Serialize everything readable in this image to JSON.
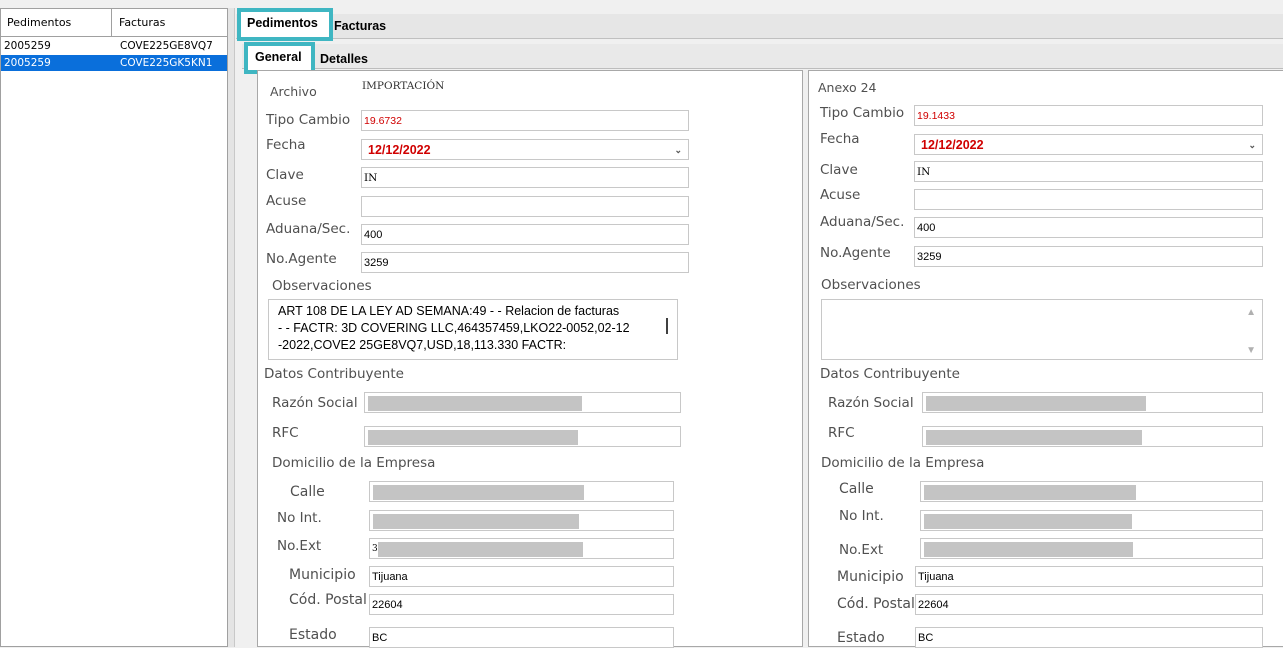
{
  "left_list": {
    "headers": [
      "Pedimentos",
      "Facturas"
    ],
    "rows": [
      {
        "pedimento": "2005259",
        "factura": "COVE225GE8VQ7",
        "selected": false
      },
      {
        "pedimento": "2005259",
        "factura": "COVE225GK5KN1",
        "selected": true
      }
    ]
  },
  "tabs": {
    "main": [
      "Pedimentos",
      "Facturas"
    ],
    "sub": [
      "General",
      "Detalles"
    ]
  },
  "left_form": {
    "archivo_label": "Archivo",
    "archivo_value": "IMPORTACIÓN",
    "tipo_cambio_label": "Tipo Cambio",
    "tipo_cambio": "19.6732",
    "fecha_label": "Fecha",
    "fecha": "12/12/2022",
    "clave_label": "Clave",
    "clave": "IN",
    "acuse_label": "Acuse",
    "acuse": "",
    "aduana_label": "Aduana/Sec.",
    "aduana": "400",
    "agente_label": "No.Agente",
    "agente": "3259",
    "obs_label": "Observaciones",
    "obs_lines": [
      "ART 108 DE LA LEY AD SEMANA:49 - - Relacion de facturas",
      "- - FACTR: 3D COVERING LLC,464357459,LKO22-0052,02-12",
      "-2022,COVE2 25GE8VQ7,USD,18,113.330 FACTR:"
    ],
    "datos_label": "Datos Contribuyente",
    "razon_label": "Razón Social",
    "rfc_label": "RFC",
    "domicilio_label": "Domicilio de la Empresa",
    "calle_label": "Calle",
    "noint_label": "No Int.",
    "noext_label": "No.Ext",
    "noext_value": "3",
    "municipio_label": "Municipio",
    "municipio": "Tijuana",
    "cp_label": "Cód. Postal",
    "cp": "22604",
    "estado_label": "Estado",
    "estado": "BC"
  },
  "right_form": {
    "anexo_label": "Anexo 24",
    "tipo_cambio_label": "Tipo Cambio",
    "tipo_cambio": "19.1433",
    "fecha_label": "Fecha",
    "fecha": "12/12/2022",
    "clave_label": "Clave",
    "clave": "IN",
    "acuse_label": "Acuse",
    "acuse": "",
    "aduana_label": "Aduana/Sec.",
    "aduana": "400",
    "agente_label": "No.Agente",
    "agente": "3259",
    "obs_label": "Observaciones",
    "datos_label": "Datos Contribuyente",
    "razon_label": "Razón Social",
    "rfc_label": "RFC",
    "domicilio_label": "Domicilio de la Empresa",
    "calle_label": "Calle",
    "noint_label": "No Int.",
    "noext_label": "No.Ext",
    "municipio_label": "Municipio",
    "municipio": "Tijuana",
    "cp_label": "Cód. Postal",
    "cp": "22604",
    "estado_label": "Estado",
    "estado": "BC"
  },
  "icons": {
    "dropdown": "chevron-down-icon",
    "scroll_up": "scroll-up-arrow-icon",
    "scroll_down": "scroll-down-arrow-icon"
  },
  "colors": {
    "selection": "#0a6fdb",
    "highlight_box": "#3fb6c2",
    "value_red": "#d00000"
  }
}
